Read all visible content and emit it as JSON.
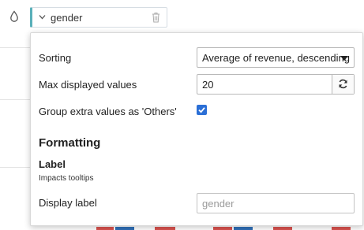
{
  "colors": {
    "pill_accent": "#59b0b9",
    "checkbox_blue": "#2b6fd6",
    "bar_red": "#d9534f",
    "bar_blue": "#2f6fb7"
  },
  "dimension_pill": {
    "label": "gender",
    "icons": [
      "drop-icon",
      "chevron-down-icon",
      "trash-icon"
    ]
  },
  "popover": {
    "sorting": {
      "label": "Sorting",
      "selected": "Average of revenue, descending"
    },
    "max_values": {
      "label": "Max displayed values",
      "value": "20"
    },
    "group_others": {
      "label": "Group extra values as 'Others'",
      "checked": true
    },
    "formatting": {
      "title": "Formatting",
      "label_title": "Label",
      "label_subtitle": "Impacts tooltips",
      "display_label": {
        "label": "Display label",
        "placeholder": "gender"
      }
    }
  }
}
